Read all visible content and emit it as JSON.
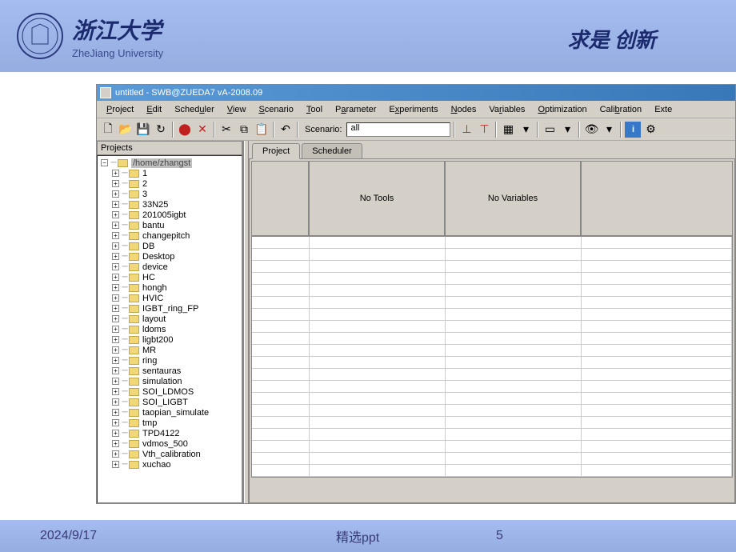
{
  "header": {
    "univ_cn": "浙江大学",
    "univ_en": "ZheJiang University",
    "motto": "求是  创新"
  },
  "app": {
    "title": "untitled - SWB@ZUEDA7 vA-2008.09",
    "menu": {
      "project": "Project",
      "edit": "Edit",
      "scheduler": "Scheduler",
      "view": "View",
      "scenario": "Scenario",
      "tool": "Tool",
      "parameter": "Parameter",
      "experiments": "Experiments",
      "nodes": "Nodes",
      "variables": "Variables",
      "optimization": "Optimization",
      "calibration": "Calibration",
      "ext": "Exte"
    },
    "toolbar": {
      "scenario_label": "Scenario:",
      "scenario_value": "all"
    },
    "projects": {
      "panel_title": "Projects",
      "root": "/home/zhangst",
      "items": [
        "1",
        "2",
        "3",
        "33N25",
        "201005igbt",
        "bantu",
        "changepitch",
        "DB",
        "Desktop",
        "device",
        "HC",
        "hongh",
        "HVIC",
        "IGBT_ring_FP",
        "layout",
        "ldoms",
        "ligbt200",
        "MR",
        "ring",
        "sentauras",
        "simulation",
        "SOI_LDMOS",
        "SOI_LIGBT",
        "taopian_simulate",
        "tmp",
        "TPD4122",
        "vdmos_500",
        "Vth_calibration",
        "xuchao"
      ]
    },
    "tabs": {
      "project": "Project",
      "scheduler": "Scheduler"
    },
    "grid": {
      "no_tools": "No Tools",
      "no_vars": "No Variables"
    }
  },
  "footer": {
    "date": "2024/9/17",
    "title": "精选ppt",
    "page": "5"
  }
}
